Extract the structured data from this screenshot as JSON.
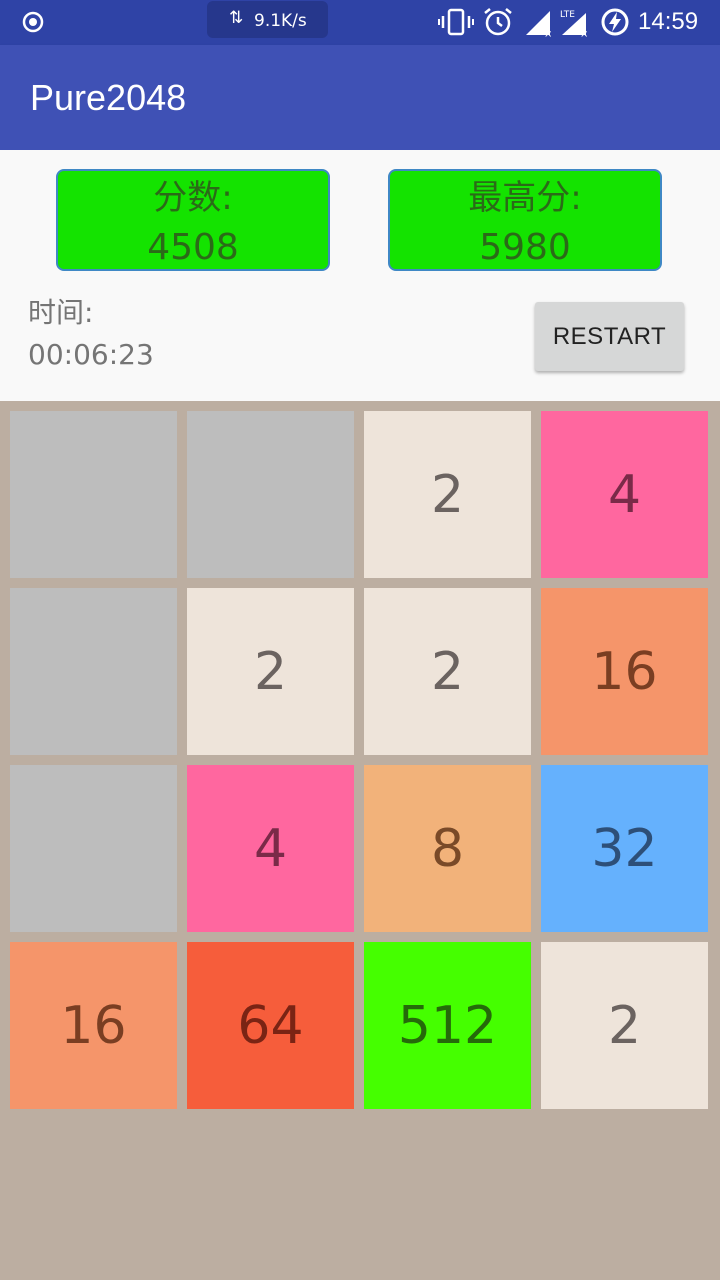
{
  "status_bar": {
    "net_speed": "9.1K/s",
    "time": "14:59",
    "icons": [
      "location-icon",
      "data-transfer-icon",
      "vibrate-icon",
      "alarm-icon",
      "signal-icon",
      "lte-signal-icon",
      "battery-charging-icon"
    ],
    "lte_label": "LTE"
  },
  "app": {
    "title": "Pure2048",
    "bar_color": "#3f51b5"
  },
  "score": {
    "label": "分数:",
    "value": "4508"
  },
  "best": {
    "label": "最高分:",
    "value": "5980"
  },
  "timer": {
    "label": "时间:",
    "value": "00:06:23"
  },
  "restart_label": "RESTART",
  "board": {
    "rows": [
      [
        "",
        "",
        "2",
        "4"
      ],
      [
        "",
        "2",
        "2",
        "16"
      ],
      [
        "",
        "4",
        "8",
        "32"
      ],
      [
        "16",
        "64",
        "512",
        "2"
      ]
    ],
    "tile_colors": {
      "empty": "#bdbdbd",
      "2": "#eee4da",
      "4": "#ff679f",
      "8": "#f2b27a",
      "16": "#f5956a",
      "32": "#65b1fd",
      "64": "#f65d3b",
      "512": "#45ff00"
    },
    "text_colors": {
      "2": "#6b6360",
      "4": "#7a2a48",
      "8": "#7a4a28",
      "16": "#7a3e22",
      "32": "#2d4f78",
      "64": "#7a2414",
      "512": "#256a0a"
    }
  }
}
